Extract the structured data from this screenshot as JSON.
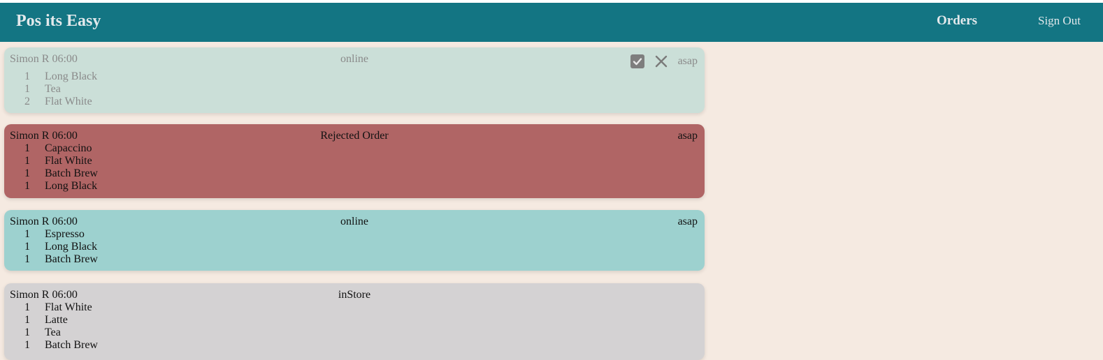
{
  "header": {
    "brand": "Pos its Easy",
    "orders_label": "Orders",
    "signout_label": "Sign Out"
  },
  "orders": [
    {
      "customer": "Simon R 06:00",
      "source": "online",
      "timing": "asap",
      "items": [
        {
          "qty": "1",
          "name": "Long Black"
        },
        {
          "qty": "1",
          "name": "Tea"
        },
        {
          "qty": "2",
          "name": "Flat White"
        }
      ],
      "actions": {
        "accept_icon": "check-square-icon",
        "reject_icon": "close-icon"
      }
    },
    {
      "customer": "Simon R 06:00",
      "source": "Rejected Order",
      "timing": "asap",
      "items": [
        {
          "qty": "1",
          "name": "Capaccino"
        },
        {
          "qty": "1",
          "name": "Flat White"
        },
        {
          "qty": "1",
          "name": "Batch Brew"
        },
        {
          "qty": "1",
          "name": "Long Black"
        }
      ]
    },
    {
      "customer": "Simon R 06:00",
      "source": "online",
      "timing": "asap",
      "items": [
        {
          "qty": "1",
          "name": "Espresso"
        },
        {
          "qty": "1",
          "name": "Long Black"
        },
        {
          "qty": "1",
          "name": "Batch Brew"
        }
      ]
    },
    {
      "customer": "Simon R 06:00",
      "source": "inStore",
      "timing": "",
      "items": [
        {
          "qty": "1",
          "name": "Flat White"
        },
        {
          "qty": "1",
          "name": "Latte"
        },
        {
          "qty": "1",
          "name": "Tea"
        },
        {
          "qty": "1",
          "name": "Batch Brew"
        }
      ]
    }
  ],
  "colors": {
    "navbar": "#137583",
    "background": "#f5eae1",
    "pending_card": "#cbdfd8",
    "rejected_card": "#b06565",
    "online_card": "#9dd1cf",
    "instore_card": "#d4d2d3"
  }
}
